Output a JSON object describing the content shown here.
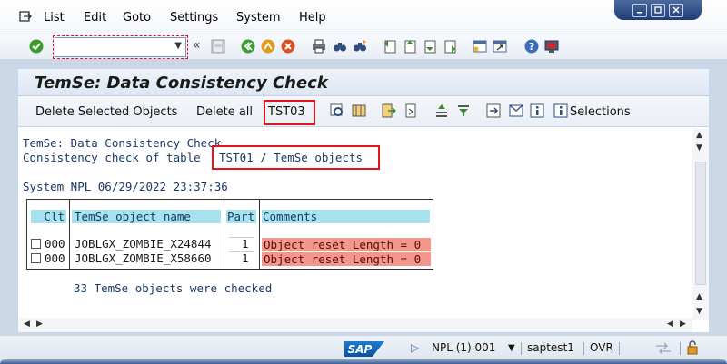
{
  "menu": {
    "items": [
      "List",
      "Edit",
      "Goto",
      "Settings",
      "System",
      "Help"
    ]
  },
  "toolbar": {
    "command_field_value": "",
    "icons": [
      "enter-icon",
      "save-icon",
      "back-icon",
      "exit-icon",
      "cancel-icon",
      "print-icon",
      "find-icon",
      "find-next-icon",
      "first-page-icon",
      "previous-page-icon",
      "next-page-icon",
      "last-page-icon",
      "new-session-icon",
      "shortcut-icon",
      "help-icon",
      "layout-icon"
    ]
  },
  "title": "TemSe: Data Consistency Check",
  "app_toolbar": {
    "delete_selected": "Delete Selected Objects",
    "delete_all": "Delete all",
    "tst03": "TST03",
    "selections": "Selections"
  },
  "content": {
    "line1": "TemSe: Data Consistency Check",
    "line2_prefix": "Consistency check of table",
    "line2_table": "TST01 / TemSe objects",
    "system_line": "System NPL 06/29/2022 23:37:36",
    "table": {
      "headers": [
        "Clt",
        "TemSe object name",
        "Part",
        "Comments"
      ],
      "rows": [
        {
          "clt": "000",
          "name": "JOBLGX_ZOMBIE_X24844",
          "part": "1",
          "comment": "Object reset Length = 0"
        },
        {
          "clt": "000",
          "name": "JOBLGX_ZOMBIE_X58660",
          "part": "1",
          "comment": "Object reset Length = 0"
        }
      ]
    },
    "summary": "33 TemSe objects were checked"
  },
  "status": {
    "logo": "SAP",
    "system": "NPL (1) 001",
    "server": "saptest1",
    "mode": "OVR"
  },
  "colors": {
    "highlight_red": "#e3141d",
    "comment_bg": "#f3978c",
    "header_bg": "#a9e2ef",
    "sap_blue": "#0b4fa0"
  }
}
